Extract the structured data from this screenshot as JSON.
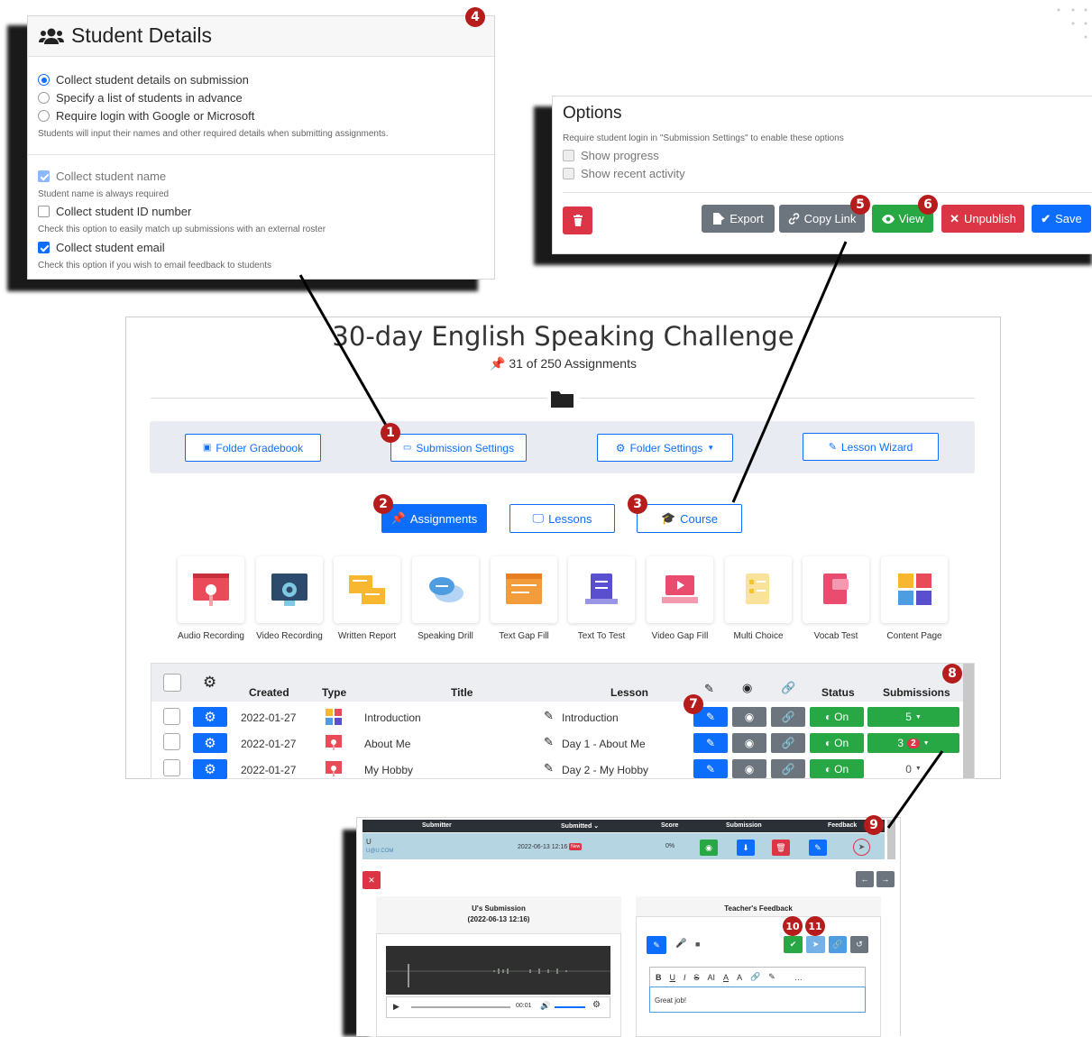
{
  "student_details": {
    "title": "Student Details",
    "options": [
      {
        "label": "Collect student details on submission",
        "selected": true
      },
      {
        "label": "Specify a list of students in advance",
        "selected": false
      },
      {
        "label": "Require login with Google or Microsoft",
        "selected": false
      }
    ],
    "options_help": "Students will input their names and other required details when submitting assignments.",
    "collect_name": "Collect student name",
    "collect_name_help": "Student name is always required",
    "collect_id": "Collect student ID number",
    "collect_id_help": "Check this option to easily match up submissions with an external roster",
    "collect_email": "Collect student email",
    "collect_email_help": "Check this option if you wish to email feedback to students"
  },
  "options_panel": {
    "title": "Options",
    "note": "Require student login in \"Submission Settings\" to enable these options",
    "show_progress": "Show progress",
    "show_recent": "Show recent activity",
    "export": "Export",
    "copy_link": "Copy Link",
    "view": "View",
    "unpublish": "Unpublish",
    "save": "Save"
  },
  "main": {
    "title": "30-day English Speaking Challenge",
    "assignment_count": "31 of 250 Assignments",
    "folder_gradebook": "Folder Gradebook",
    "submission_settings": "Submission Settings",
    "folder_settings": "Folder Settings",
    "lesson_wizard": "Lesson Wizard",
    "tabs": {
      "assignments": "Assignments",
      "lessons": "Lessons",
      "course": "Course"
    },
    "types": [
      "Audio Recording",
      "Video Recording",
      "Written Report",
      "Speaking Drill",
      "Text Gap Fill",
      "Text To Test",
      "Video Gap Fill",
      "Multi Choice",
      "Vocab Test",
      "Content Page"
    ],
    "table": {
      "headers": {
        "created": "Created",
        "type": "Type",
        "title": "Title",
        "lesson": "Lesson",
        "status": "Status",
        "submissions": "Submissions"
      },
      "rows": [
        {
          "created": "2022-01-27",
          "title": "Introduction",
          "lesson": "Introduction",
          "status": "On",
          "submissions": "5",
          "new": ""
        },
        {
          "created": "2022-01-27",
          "title": "About Me",
          "lesson": "Day 1 - About Me",
          "status": "On",
          "submissions": "3",
          "new": "2"
        },
        {
          "created": "2022-01-27",
          "title": "My Hobby",
          "lesson": "Day 2 - My Hobby",
          "status": "On",
          "submissions": "0",
          "new": ""
        }
      ]
    }
  },
  "submission_panel": {
    "headers": {
      "submitter": "Submitter",
      "submitted": "Submitted",
      "score": "Score",
      "submission": "Submission",
      "feedback": "Feedback"
    },
    "row": {
      "name": "U",
      "email": "U@U.COM",
      "date": "2022-06-13 12:16",
      "new_tag": "New",
      "score": "0%"
    },
    "user_submission_title": "U's Submission",
    "user_submission_date": "(2022-06-13 12:16)",
    "audio_time": "00:01",
    "feedback_title": "Teacher's Feedback",
    "feedback_text": "Great job!",
    "editor_tools": [
      "B",
      "U",
      "I",
      "S",
      "AI",
      "A",
      "A",
      "…"
    ]
  },
  "callouts": [
    "1",
    "2",
    "3",
    "4",
    "5",
    "6",
    "7",
    "8",
    "9",
    "10",
    "11"
  ],
  "colors": {
    "primary": "#0d6efd",
    "success": "#28a745",
    "danger": "#dc3545",
    "secondary": "#6c757d",
    "callout": "#b71c1c"
  }
}
